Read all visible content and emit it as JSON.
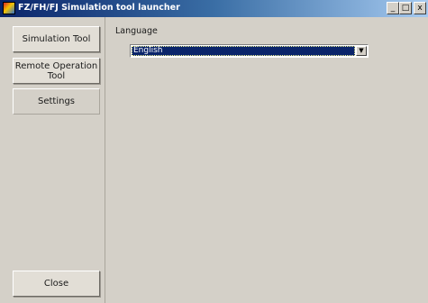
{
  "window": {
    "title": "FZ/FH/FJ Simulation tool launcher",
    "controls": {
      "minimize": "_",
      "maximize": "□",
      "close": "x"
    }
  },
  "sidebar": {
    "items": [
      {
        "label": "Simulation Tool"
      },
      {
        "label": "Remote Operation Tool"
      },
      {
        "label": "Settings"
      }
    ],
    "close_label": "Close"
  },
  "settings": {
    "language_label": "Language",
    "language_value": "English"
  },
  "icons": {
    "app": "app-icon",
    "dropdown": "chevron-down-icon"
  }
}
